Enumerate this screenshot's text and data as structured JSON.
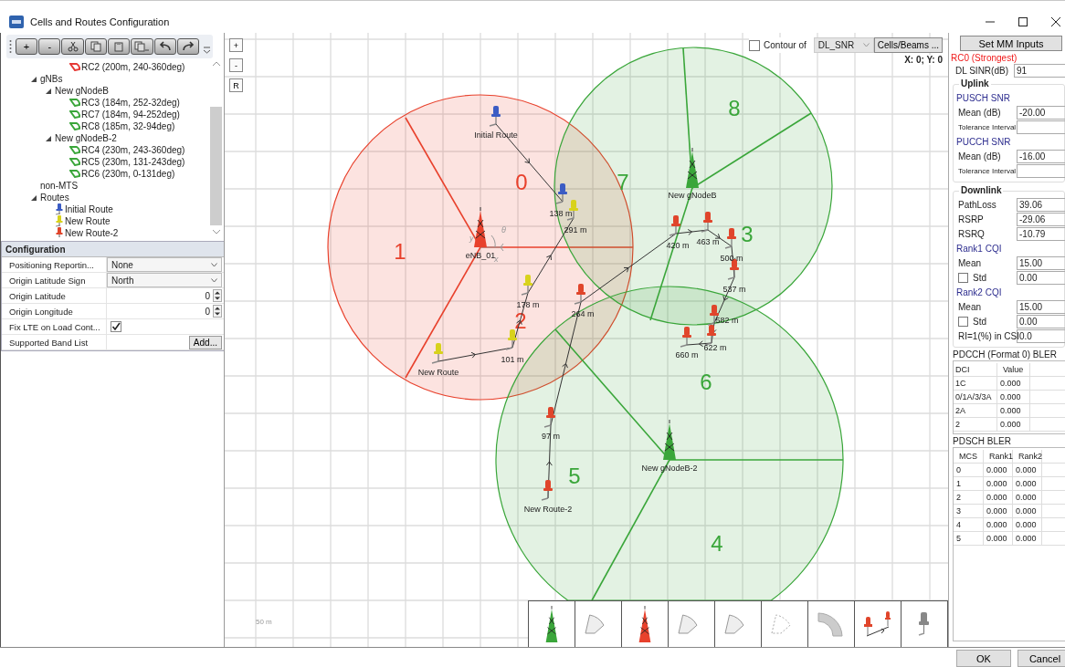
{
  "window": {
    "title": "Cells and Routes Configuration"
  },
  "tree_toolbar": {
    "add": "+",
    "remove": "-"
  },
  "tree": {
    "cut_item": {
      "label": "RC2 (200m, 240-360deg)",
      "color": "#e53935"
    },
    "items": [
      {
        "label": "gNBs",
        "expanded": true,
        "children": [
          {
            "label": "New gNodeB",
            "expanded": true,
            "children": [
              {
                "kind": "cell",
                "label": "RC3 (184m, 252-32deg)",
                "color": "#3aa63a"
              },
              {
                "kind": "cell",
                "label": "RC7 (184m, 94-252deg)",
                "color": "#3aa63a"
              },
              {
                "kind": "cell",
                "label": "RC8 (185m, 32-94deg)",
                "color": "#3aa63a"
              }
            ]
          },
          {
            "label": "New gNodeB-2",
            "expanded": true,
            "children": [
              {
                "kind": "cell",
                "label": "RC4 (230m, 243-360deg)",
                "color": "#3aa63a"
              },
              {
                "kind": "cell",
                "label": "RC5 (230m, 131-243deg)",
                "color": "#3aa63a"
              },
              {
                "kind": "cell",
                "label": "RC6 (230m, 0-131deg)",
                "color": "#3aa63a"
              }
            ]
          }
        ]
      },
      {
        "label": "non-MTS"
      },
      {
        "label": "Routes",
        "expanded": true,
        "children": [
          {
            "kind": "route",
            "label": "Initial Route",
            "color": "#3b5cc4"
          },
          {
            "kind": "route",
            "label": "New Route",
            "color": "#d8d21c"
          },
          {
            "kind": "route",
            "label": "New Route-2",
            "color": "#e0452b"
          }
        ]
      }
    ]
  },
  "configuration": {
    "title": "Configuration",
    "rows": [
      {
        "kind": "select",
        "label": "Positioning Reportin...",
        "value": "None"
      },
      {
        "kind": "select",
        "label": "Origin Latitude Sign",
        "value": "North"
      },
      {
        "kind": "spin",
        "label": "Origin Latitude",
        "value": "0"
      },
      {
        "kind": "spin",
        "label": "Origin Longitude",
        "value": "0"
      },
      {
        "kind": "check",
        "label": "Fix LTE on Load Cont...",
        "checked": true
      },
      {
        "kind": "button",
        "label": "Supported Band List",
        "button": "Add..."
      }
    ]
  },
  "map": {
    "zoom_buttons": [
      "+",
      "-",
      "R"
    ],
    "contour": {
      "label": "Contour of",
      "checked": false,
      "metric": "DL_SNR",
      "button": "Cells/Beams ..."
    },
    "cursor": "X: 0; Y: 0",
    "scale": "50 m",
    "axis_labels": [
      "x",
      "y",
      "θ"
    ],
    "sites": [
      {
        "name": "eNB_01",
        "color": "#e8412c",
        "sectors": [
          "0",
          "1",
          "2"
        ]
      },
      {
        "name": "New gNodeB",
        "color": "#3aa63a",
        "sectors": [
          "8",
          "7",
          "3"
        ]
      },
      {
        "name": "New gNodeB-2",
        "color": "#3aa63a",
        "sectors": [
          "6",
          "5",
          "4"
        ]
      }
    ],
    "routes": [
      {
        "name": "Initial Route",
        "color": "#3b5cc4",
        "points": [
          "138 m"
        ]
      },
      {
        "name": "New Route",
        "color": "#d8d21c",
        "points": [
          "101 m",
          "178 m",
          "291 m"
        ]
      },
      {
        "name": "New Route-2",
        "color": "#e0452b",
        "points": [
          "97 m",
          "264 m",
          "420 m",
          "463 m",
          "500 m",
          "537 m",
          "582 m",
          "622 m",
          "660 m"
        ]
      }
    ]
  },
  "mm_panel": {
    "button": "Set MM Inputs",
    "cell": "RC0 (Strongest)",
    "dl_sinr": {
      "label": "DL SINR(dB)",
      "value": "91"
    },
    "uplink": {
      "title": "Uplink",
      "groups": [
        {
          "title": "PUSCH SNR",
          "mean": {
            "label": "Mean (dB)",
            "value": "-20.00"
          },
          "tolerance": "Tolerance Interval"
        },
        {
          "title": "PUCCH SNR",
          "mean": {
            "label": "Mean (dB)",
            "value": "-16.00"
          },
          "tolerance": "Tolerance Interval"
        }
      ]
    },
    "downlink": {
      "title": "Downlink",
      "fields": [
        {
          "label": "PathLoss",
          "value": "39.06"
        },
        {
          "label": "RSRP",
          "value": "-29.06"
        },
        {
          "label": "RSRQ",
          "value": "-10.79"
        }
      ],
      "cqi": [
        {
          "title": "Rank1 CQI",
          "mean": {
            "label": "Mean",
            "value": "15.00"
          },
          "std": {
            "label": "Std",
            "checked": false,
            "value": "0.00"
          }
        },
        {
          "title": "Rank2 CQI",
          "mean": {
            "label": "Mean",
            "value": "15.00"
          },
          "std": {
            "label": "Std",
            "checked": false,
            "value": "0.00"
          }
        }
      ],
      "ri": {
        "label": "RI=1(%) in CSI",
        "value": "0.0"
      }
    },
    "pdcch": {
      "title": "PDCCH (Format 0) BLER",
      "columns": [
        "DCI",
        "Value"
      ],
      "rows": [
        [
          "1C",
          "0.000"
        ],
        [
          "0/1A/3/3A",
          "0.000"
        ],
        [
          "2A",
          "0.000"
        ],
        [
          "2",
          "0.000"
        ]
      ]
    },
    "pdsch": {
      "title": "PDSCH BLER",
      "columns": [
        "MCS",
        "Rank1",
        "Rank2"
      ],
      "rows": [
        [
          "0",
          "0.000",
          "0.000"
        ],
        [
          "1",
          "0.000",
          "0.000"
        ],
        [
          "2",
          "0.000",
          "0.000"
        ],
        [
          "3",
          "0.000",
          "0.000"
        ],
        [
          "4",
          "0.000",
          "0.000"
        ],
        [
          "5",
          "0.000",
          "0.000"
        ]
      ]
    }
  },
  "buttons": [
    "OK",
    "Cancel"
  ]
}
